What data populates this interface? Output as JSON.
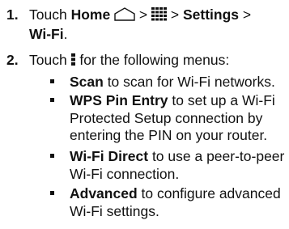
{
  "steps": [
    {
      "number": "1.",
      "text_before": "Touch ",
      "home_label": "Home",
      "sep1": " > ",
      "sep2": " > ",
      "settings_label": "Settings",
      "sep3": " >",
      "wifi_label": "Wi-Fi",
      "end": ".",
      "icons": [
        "home-icon",
        "apps-grid-icon"
      ]
    },
    {
      "number": "2.",
      "text_before": "Touch ",
      "text_after": " for the following menus:",
      "icons": [
        "menu-dots-icon"
      ]
    }
  ],
  "menu_items": [
    {
      "name": "Scan",
      "description": " to scan for Wi-Fi networks."
    },
    {
      "name": "WPS Pin Entry",
      "description": " to set up a Wi-Fi Protected Setup connection by entering the PIN on your router."
    },
    {
      "name": "Wi-Fi Direct",
      "description": " to use a peer-to-peer Wi-Fi connection."
    },
    {
      "name": "Advanced",
      "description": " to configure advanced Wi-Fi settings."
    }
  ]
}
